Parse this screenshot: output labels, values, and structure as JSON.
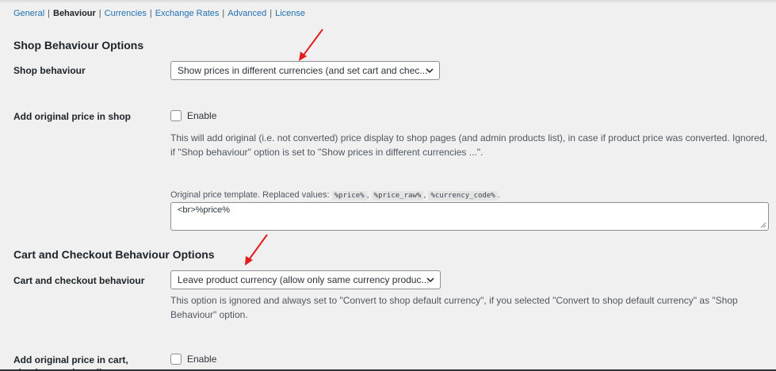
{
  "subnav": {
    "items": [
      "General",
      "Behaviour",
      "Currencies",
      "Exchange Rates",
      "Advanced",
      "License"
    ],
    "separator": "|"
  },
  "shop_section": {
    "title": "Shop Behaviour Options",
    "shop_behaviour": {
      "label": "Shop behaviour",
      "selected": "Show prices in different currencies (and set cart and chec..."
    },
    "add_original_price": {
      "label": "Add original price in shop",
      "checkbox_label": "Enable",
      "description": "This will add original (i.e. not converted) price display to shop pages (and admin products list), in case if product price was converted. Ignored, if \"Shop behaviour\" option is set to \"Show prices in different currencies ...\"."
    },
    "template": {
      "label": "Original price template. Replaced values:",
      "codes": [
        "%price%",
        "%price_raw%",
        "%currency_code%"
      ],
      "comma": ",",
      "period": ".",
      "value": "<br>%price%"
    }
  },
  "cart_section": {
    "title": "Cart and Checkout Behaviour Options",
    "cart_behaviour": {
      "label": "Cart and checkout behaviour",
      "selected": "Leave product currency (allow only same currency produc...",
      "description": "This option is ignored and always set to \"Convert to shop default currency\", if you selected \"Convert to shop default currency\" as \"Shop Behaviour\" option."
    },
    "add_original_cart": {
      "label": "Add original price in cart, checkout and emails",
      "checkbox_label": "Enable"
    }
  },
  "colors": {
    "link": "#2271b1",
    "arrow": "#e01e1e",
    "background": "#f0f0f1"
  }
}
